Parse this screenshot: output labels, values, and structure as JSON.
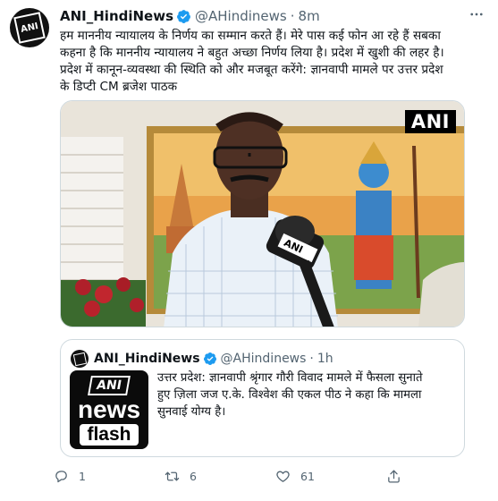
{
  "tweet": {
    "author_name": "ANI_HindiNews",
    "handle": "@AHindinews",
    "separator": "·",
    "time": "8m",
    "text_lines": [
      "हम माननीय न्यायालय के निर्णय का सम्मान करते हैं। मेरे पास कई फोन आ रहे हैं सबका",
      "कहना है कि माननीय न्यायालय ने बहुत अच्छा निर्णय लिया है। प्रदेश में खुशी की लहर है।",
      "प्रदेश में कानून-व्यवस्था की स्थिति को और मजबूत करेंगे: ज्ञानवापी मामले पर उत्तर प्रदेश",
      "के डिप्टी CM ब्रजेश पाठक"
    ],
    "media_watermark": "ANI",
    "more_icon": "ellipsis-icon",
    "verified_color": "#1d9bf0"
  },
  "quote": {
    "author_name": "ANI_HindiNews",
    "handle": "@AHindinews",
    "separator": "·",
    "time": "1h",
    "thumbnail": {
      "line1": "ANI",
      "line2": "news",
      "line3": "flash"
    },
    "text_lines": [
      "उत्तर प्रदेश: ज्ञानवापी श्रृंगार गौरी विवाद मामले में फैसला सुनाते",
      "हुए ज़िला जज ए.के. विश्वेश की एकल पीठ ने कहा कि मामला",
      "सुनवाई योग्य है।"
    ]
  },
  "actions": {
    "reply_count": "1",
    "retweet_count": "6",
    "like_count": "61",
    "reply_icon": "reply-icon",
    "retweet_icon": "retweet-icon",
    "like_icon": "heart-icon",
    "share_icon": "share-icon"
  }
}
